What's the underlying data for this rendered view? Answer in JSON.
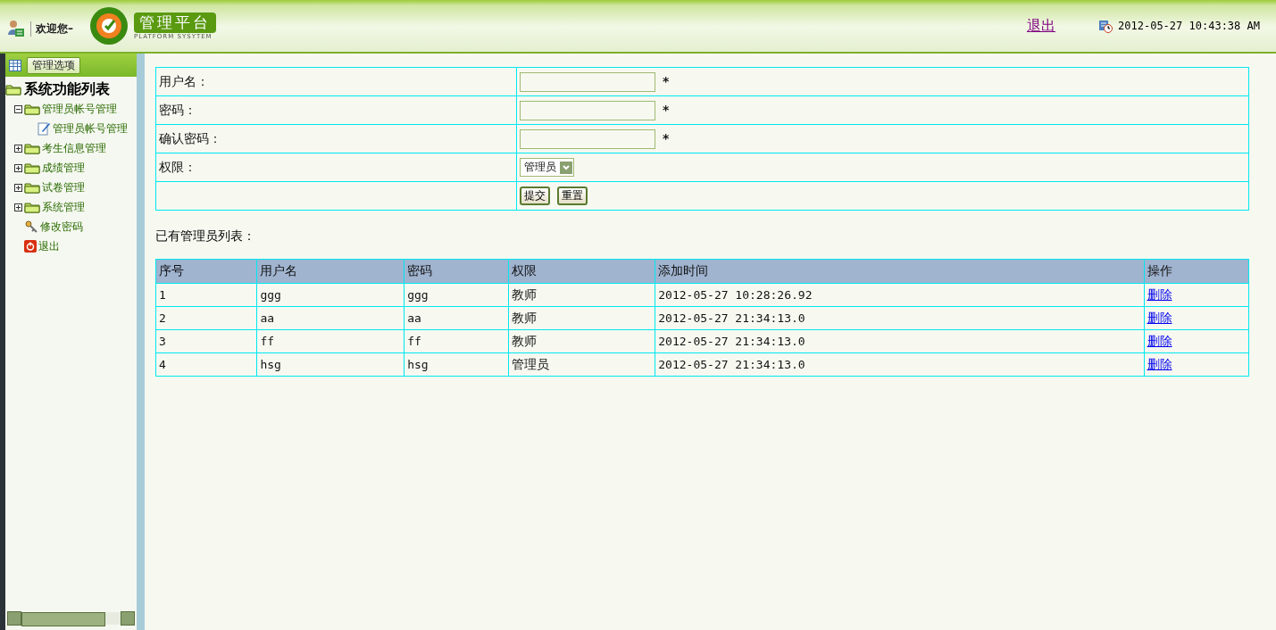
{
  "header": {
    "greeting": "欢迎您–",
    "logo_title": "管理平台",
    "logo_subtitle": "PLATFORM SYSYTEM",
    "logout": "退出",
    "datetime": "2012-05-27 10:43:38 AM"
  },
  "sidebar": {
    "tab": "管理选项",
    "tree_title": "系统功能列表",
    "items": [
      {
        "kind": "folder",
        "label": "管理员帐号管理",
        "expanded": true,
        "children": [
          {
            "kind": "page",
            "label": "管理员帐号管理"
          }
        ]
      },
      {
        "kind": "folder",
        "label": "考生信息管理",
        "expanded": false
      },
      {
        "kind": "folder",
        "label": "成绩管理",
        "expanded": false
      },
      {
        "kind": "folder",
        "label": "试卷管理",
        "expanded": false
      },
      {
        "kind": "folder",
        "label": "系统管理",
        "expanded": false
      },
      {
        "kind": "key",
        "label": "修改密码"
      },
      {
        "kind": "exit",
        "label": "退出"
      }
    ]
  },
  "form": {
    "fields": [
      {
        "kind": "text",
        "label": "用户名：",
        "required": "*"
      },
      {
        "kind": "password",
        "label": "密码：",
        "required": "*"
      },
      {
        "kind": "password",
        "label": "确认密码：",
        "required": "*"
      },
      {
        "kind": "select",
        "label": "权限：",
        "value": "管理员"
      }
    ],
    "buttons": [
      "提交",
      "重置"
    ]
  },
  "list_title": "已有管理员列表：",
  "table": {
    "columns": [
      "序号",
      "用户名",
      "密码",
      "权限",
      "添加时间",
      "操作"
    ],
    "rows": [
      [
        "1",
        "ggg",
        "ggg",
        "教师",
        "2012-05-27 10:28:26.92",
        "删除"
      ],
      [
        "2",
        "aa",
        "aa",
        "教师",
        "2012-05-27 21:34:13.0",
        "删除"
      ],
      [
        "3",
        "ff",
        "ff",
        "教师",
        "2012-05-27 21:34:13.0",
        "删除"
      ],
      [
        "4",
        "hsg",
        "hsg",
        "管理员",
        "2012-05-27 21:34:13.0",
        "删除"
      ]
    ]
  }
}
